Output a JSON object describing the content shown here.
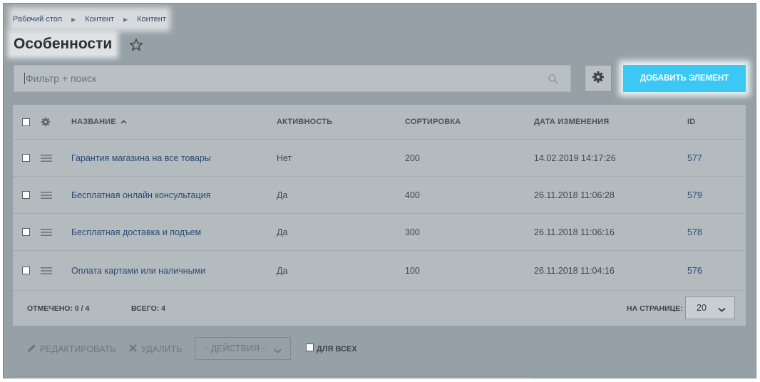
{
  "breadcrumb": [
    "Рабочий стол",
    "Контент",
    "Контент"
  ],
  "page": {
    "title": "Особенности"
  },
  "filter": {
    "placeholder": "Фильтр + поиск"
  },
  "toolbar": {
    "add_label": "ДОБАВИТЬ ЭЛЕМЕНТ"
  },
  "table": {
    "columns": {
      "name": "НАЗВАНИЕ",
      "active": "АКТИВНОСТЬ",
      "sort": "СОРТИРОВКА",
      "date": "ДАТА ИЗМЕНЕНИЯ",
      "id": "ID"
    },
    "sort_indicator": "^",
    "rows": [
      {
        "name": "Гарантия магазина на все товары",
        "active": "Нет",
        "sort": "200",
        "date": "14.02.2019 14:17:26",
        "id": "577"
      },
      {
        "name": "Бесплатная онлайн консультация",
        "active": "Да",
        "sort": "400",
        "date": "26.11.2018 11:06:28",
        "id": "579"
      },
      {
        "name": "Бесплатная доставка и подъем",
        "active": "Да",
        "sort": "300",
        "date": "26.11.2018 11:06:16",
        "id": "578"
      },
      {
        "name": "Оплата картами или наличными",
        "active": "Да",
        "sort": "100",
        "date": "26.11.2018 11:04:16",
        "id": "576"
      }
    ]
  },
  "footer": {
    "selected_label": "ОТМЕЧЕНО:",
    "selected_value": "0 / 4",
    "total_label": "ВСЕГО:",
    "total_value": "4",
    "per_page_label": "НА СТРАНИЦЕ:",
    "per_page_value": "20"
  },
  "actions": {
    "edit_label": "РЕДАКТИРОВАТЬ",
    "delete_label": "УДАЛИТЬ",
    "dropdown_label": "- ДЕЙСТВИЯ -",
    "for_all_label": "ДЛЯ ВСЕХ"
  }
}
